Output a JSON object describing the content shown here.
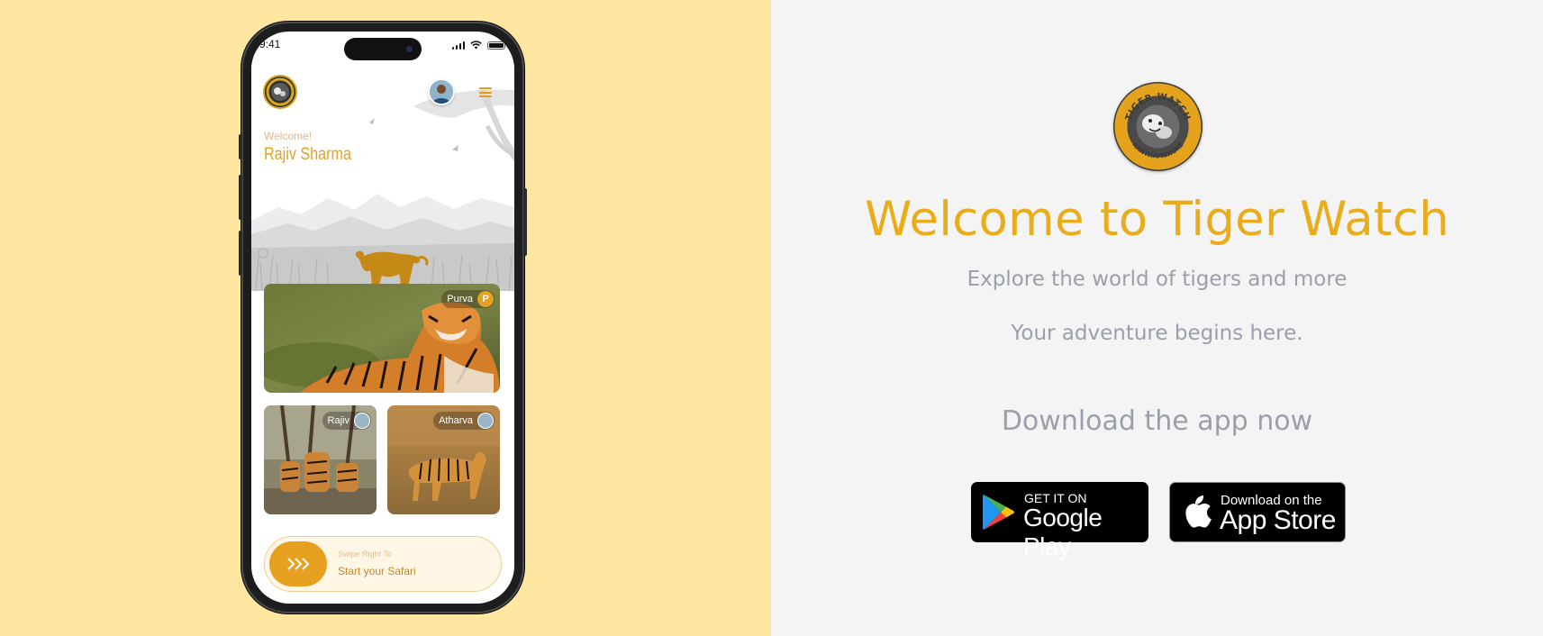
{
  "phone": {
    "status_time": "9:41",
    "welcome_label": "Welcome!",
    "user_name": "Rajiv Sharma",
    "cards": [
      {
        "tag": "Purva",
        "badge": "P"
      },
      {
        "tag": "Rajiv"
      },
      {
        "tag": "Atharva"
      }
    ],
    "swipe": {
      "hint": "Swipe Right To",
      "label": "Start your Safari"
    }
  },
  "landing": {
    "headline": "Welcome to Tiger Watch",
    "subtitle": "Explore the world of tigers and more",
    "tagline": "Your adventure begins here.",
    "download_title": "Download the app now",
    "google_play": {
      "small": "GET IT ON",
      "big": "Google Play"
    },
    "app_store": {
      "small": "Download on the",
      "big": "App Store"
    },
    "logo_text_top": "TIGER WATCH",
    "logo_text_bottom": "RANTHAMBHORE"
  },
  "colors": {
    "left_background": "#ffe7a2",
    "right_background": "#f4f4f4",
    "accent": "#e9ad1b",
    "muted_text": "#9a9fab"
  },
  "icons": [
    "menu-icon",
    "swipe-arrows-icon",
    "google-play-icon",
    "apple-icon",
    "signal-icon",
    "wifi-icon",
    "battery-icon"
  ]
}
